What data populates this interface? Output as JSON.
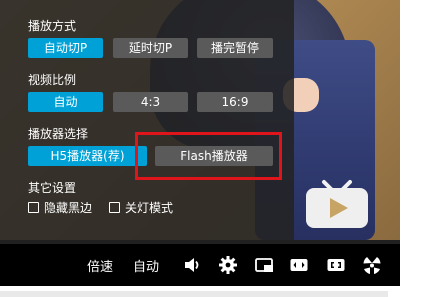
{
  "menu": {
    "play_mode": {
      "title": "播放方式",
      "options": [
        "自动切P",
        "延时切P",
        "播完暂停"
      ],
      "selected": 0
    },
    "aspect_ratio": {
      "title": "视频比例",
      "options": [
        "自动",
        "4:3",
        "16:9"
      ],
      "selected": 0
    },
    "player_select": {
      "title": "播放器选择",
      "options": [
        "H5播放器(荐)",
        "Flash播放器"
      ],
      "selected": 0
    },
    "other_settings": {
      "title": "其它设置",
      "options": [
        "隐藏黑边",
        "关灯模式"
      ]
    }
  },
  "controls": {
    "speed_label": "倍速",
    "quality_label": "自动",
    "icons": [
      "volume-icon",
      "settings-gear-icon",
      "picture-in-picture-icon",
      "widescreen-icon",
      "web-fullscreen-icon",
      "fullscreen-icon"
    ]
  },
  "progress": {
    "fraction": 0.0
  },
  "colors": {
    "accent": "#00a1d6",
    "highlight": "#e0141b",
    "button": "#5a5a5a"
  }
}
